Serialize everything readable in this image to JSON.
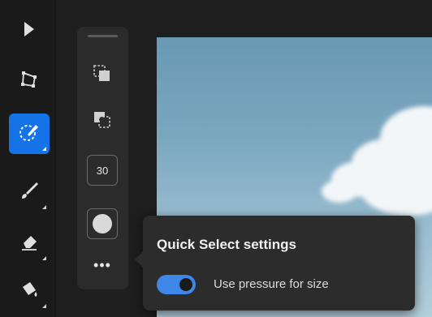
{
  "toolbar": {
    "tools": [
      {
        "name": "select-arrow-icon",
        "active": false
      },
      {
        "name": "transform-icon",
        "active": false
      },
      {
        "name": "quick-select-icon",
        "active": true
      },
      {
        "name": "brush-icon",
        "active": false
      },
      {
        "name": "eraser-icon",
        "active": false
      },
      {
        "name": "fill-bucket-icon",
        "active": false
      }
    ],
    "accent_color": "#1473e6"
  },
  "options": {
    "icons": [
      "add-to-selection-icon",
      "subtract-from-selection-icon"
    ],
    "brush_size": "30",
    "color_swatch": "#d9d9d9",
    "more_label": "•••"
  },
  "popover": {
    "title": "Quick Select settings",
    "toggle_label": "Use pressure for size",
    "toggle_on": true
  }
}
